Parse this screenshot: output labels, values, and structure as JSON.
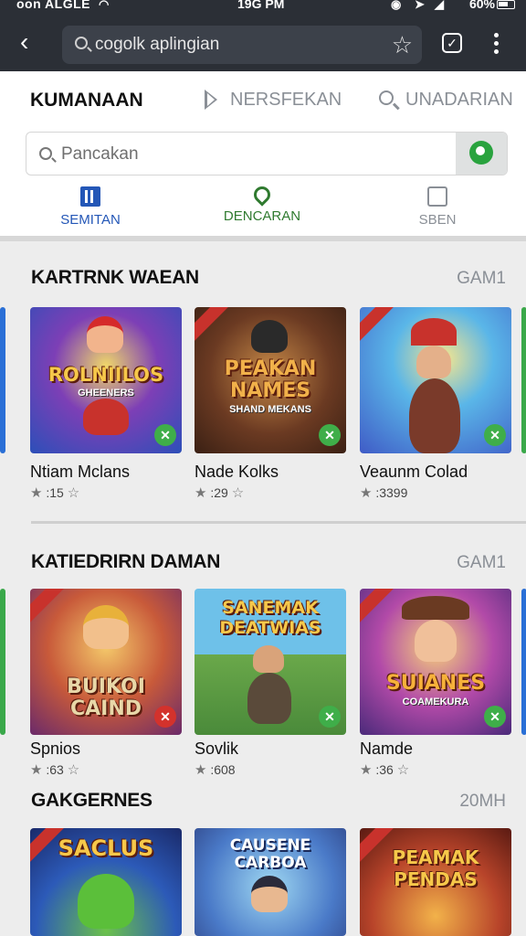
{
  "status_bar": {
    "carrier": "oon ALGLE",
    "time": "19G PM",
    "battery": "60%"
  },
  "browser": {
    "url_text": "cogolk aplingian"
  },
  "top_tabs": [
    {
      "label": "KUMANAAN"
    },
    {
      "label": "NERSFEKAN"
    },
    {
      "label": "UNADARIAN"
    }
  ],
  "search": {
    "placeholder": "Pancakan"
  },
  "categories": [
    {
      "label": "SEMITAN",
      "icon": "chart-icon"
    },
    {
      "label": "DENCARAN",
      "icon": "pin-icon"
    },
    {
      "label": "SBEN",
      "icon": "bag-icon"
    }
  ],
  "sections": [
    {
      "title": "KARTRNK WAEAN",
      "more": "GAM1",
      "items": [
        {
          "name": "Ntiam Mclans",
          "rating": ":15",
          "art_title": "ROLNIILOS",
          "art_sub": "GHEENERS"
        },
        {
          "name": "Nade Kolks",
          "rating": ":29",
          "art_title": "PEAKAN NAMES",
          "art_sub": "SHAND MEKANS"
        },
        {
          "name": "Veaunm Colad",
          "rating": ":3399",
          "art_title": "",
          "art_sub": ""
        }
      ]
    },
    {
      "title": "KATIEDRIRN DAMAN",
      "more": "GAM1",
      "items": [
        {
          "name": "Spnios",
          "rating": ":63",
          "art_title": "BUIKOI CAIND",
          "art_sub": ""
        },
        {
          "name": "Sovlik",
          "rating": ":608",
          "art_title": "SANEMAK DEATWIAS",
          "art_sub": ""
        },
        {
          "name": "Namde",
          "rating": ":36",
          "art_title": "SUIANES",
          "art_sub": "COAMEKURA"
        }
      ]
    },
    {
      "title": "GAKGERNES",
      "more": "20MH",
      "items": [
        {
          "art_title": "SACLUS",
          "art_sub": ""
        },
        {
          "art_title": "CAUSENE CARBOA",
          "art_sub": ""
        },
        {
          "art_title": "PEAMAK PENDAS",
          "art_sub": ""
        }
      ]
    }
  ],
  "colors": {
    "browser_bar": "#2b2f36",
    "accent_blue": "#2457b7",
    "accent_green": "#2f7a2f",
    "badge_green": "#3fae49",
    "badge_red": "#d3322c"
  }
}
